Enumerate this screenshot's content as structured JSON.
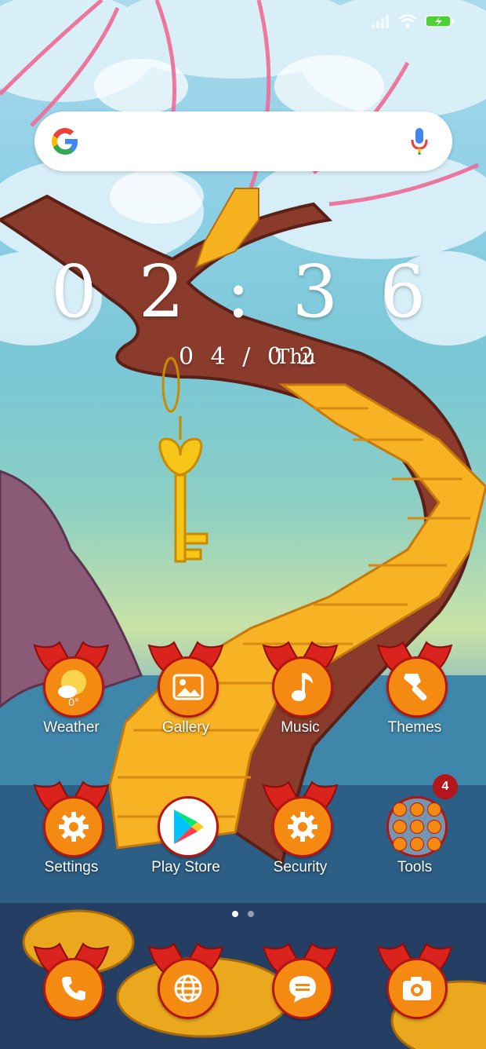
{
  "clock": {
    "time": "0 2 : 3 6",
    "date": "0 4 / 0 2",
    "day": "Thu"
  },
  "weather": {
    "temp": "0°"
  },
  "apps": [
    {
      "label": "Weather"
    },
    {
      "label": "Gallery"
    },
    {
      "label": "Music"
    },
    {
      "label": "Themes"
    },
    {
      "label": "Settings"
    },
    {
      "label": "Play Store"
    },
    {
      "label": "Security"
    },
    {
      "label": "Tools",
      "badge": "4"
    }
  ],
  "colors": {
    "icon_bg": "#f58a12",
    "wing": "#d9231c",
    "border": "#b5150d"
  }
}
